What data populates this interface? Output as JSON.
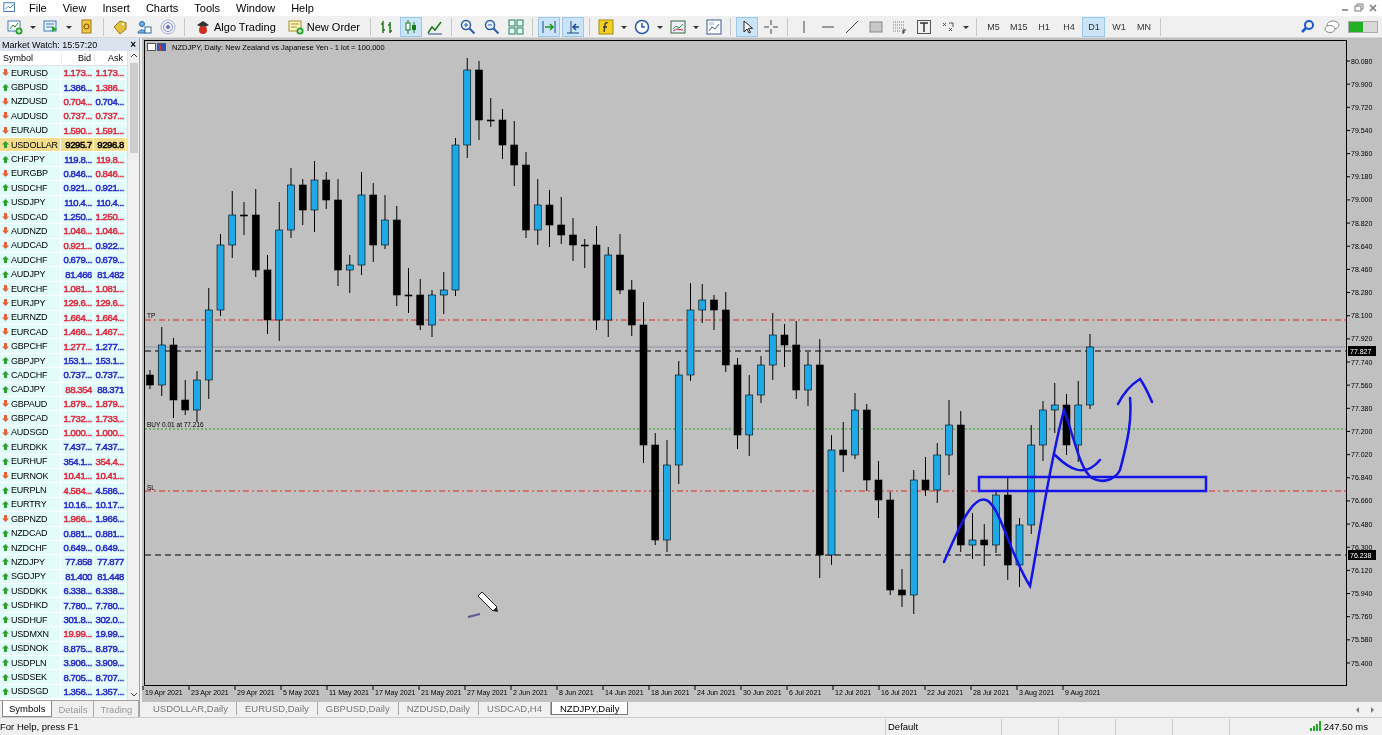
{
  "menu": [
    "File",
    "View",
    "Insert",
    "Charts",
    "Tools",
    "Window",
    "Help"
  ],
  "toolbar": {
    "buttons": [
      "Algo Trading",
      "New Order"
    ],
    "chart_types": [
      {
        "selected": false
      },
      {
        "selected": true
      },
      {
        "selected": false
      }
    ],
    "chart_shift": {
      "on": true
    },
    "auto_scroll": {
      "on": true
    },
    "tools": [
      {
        "selected": true
      },
      {
        "selected": false
      },
      {
        "selected": false
      },
      {
        "selected": false
      },
      {
        "selected": false
      },
      {
        "selected": false
      },
      {
        "selected": false
      },
      {
        "selected": false
      },
      {
        "selected": false
      }
    ],
    "timeframes": [
      {
        "label": "M5",
        "selected": false
      },
      {
        "label": "M15",
        "selected": false
      },
      {
        "label": "H1",
        "selected": false
      },
      {
        "label": "H4",
        "selected": false
      },
      {
        "label": "D1",
        "selected": true
      },
      {
        "label": "W1",
        "selected": false
      },
      {
        "label": "MN",
        "selected": false
      }
    ]
  },
  "market_watch": {
    "title": "Market Watch: 15:57:20",
    "close": "×",
    "columns": [
      "Symbol",
      "Bid",
      "Ask"
    ],
    "rows": [
      {
        "symbol": "EURUSD",
        "rising": false,
        "bid": {
          "text": "1.173...",
          "color": "#e0283c"
        },
        "ask": {
          "text": "1.173...",
          "color": "#e0283c"
        },
        "selected": false
      },
      {
        "symbol": "GBPUSD",
        "rising": true,
        "bid": {
          "text": "1.386...",
          "color": "#2a2ac8"
        },
        "ask": {
          "text": "1.386...",
          "color": "#e0283c"
        },
        "selected": false
      },
      {
        "symbol": "NZDUSD",
        "rising": false,
        "bid": {
          "text": "0.704...",
          "color": "#e0283c"
        },
        "ask": {
          "text": "0.704...",
          "color": "#2a2ac8"
        },
        "selected": false
      },
      {
        "symbol": "AUDUSD",
        "rising": false,
        "bid": {
          "text": "0.737...",
          "color": "#e0283c"
        },
        "ask": {
          "text": "0.737...",
          "color": "#e0283c"
        },
        "selected": false
      },
      {
        "symbol": "EURAUD",
        "rising": false,
        "bid": {
          "text": "1.590...",
          "color": "#e0283c"
        },
        "ask": {
          "text": "1.591...",
          "color": "#e0283c"
        },
        "selected": false
      },
      {
        "symbol": "USDOLLAR",
        "rising": true,
        "bid": {
          "text": "9295.7"
        },
        "ask": {
          "text": "9296.8"
        },
        "selected": true
      },
      {
        "symbol": "CHFJPY",
        "rising": true,
        "bid": {
          "text": "119.8...",
          "color": "#2a2ac8"
        },
        "ask": {
          "text": "119.8...",
          "color": "#e0283c"
        },
        "selected": false
      },
      {
        "symbol": "EURGBP",
        "rising": false,
        "bid": {
          "text": "0.846...",
          "color": "#2a2ac8"
        },
        "ask": {
          "text": "0.846...",
          "color": "#e0283c"
        },
        "selected": false
      },
      {
        "symbol": "USDCHF",
        "rising": true,
        "bid": {
          "text": "0.921...",
          "color": "#2a2ac8"
        },
        "ask": {
          "text": "0.921...",
          "color": "#2a2ac8"
        },
        "selected": false
      },
      {
        "symbol": "USDJPY",
        "rising": true,
        "bid": {
          "text": "110.4...",
          "color": "#2a2ac8"
        },
        "ask": {
          "text": "110.4...",
          "color": "#2a2ac8"
        },
        "selected": false
      },
      {
        "symbol": "USDCAD",
        "rising": false,
        "bid": {
          "text": "1.250...",
          "color": "#2a2ac8"
        },
        "ask": {
          "text": "1.250...",
          "color": "#e0283c"
        },
        "selected": false
      },
      {
        "symbol": "AUDNZD",
        "rising": false,
        "bid": {
          "text": "1.046...",
          "color": "#e0283c"
        },
        "ask": {
          "text": "1.046...",
          "color": "#e0283c"
        },
        "selected": false
      },
      {
        "symbol": "AUDCAD",
        "rising": false,
        "bid": {
          "text": "0.921...",
          "color": "#e0283c"
        },
        "ask": {
          "text": "0.922...",
          "color": "#2a2ac8"
        },
        "selected": false
      },
      {
        "symbol": "AUDCHF",
        "rising": true,
        "bid": {
          "text": "0.679...",
          "color": "#2a2ac8"
        },
        "ask": {
          "text": "0.679...",
          "color": "#2a2ac8"
        },
        "selected": false
      },
      {
        "symbol": "AUDJPY",
        "rising": true,
        "bid": {
          "text": "81.466",
          "color": "#2a2ac8"
        },
        "ask": {
          "text": "81.482",
          "color": "#2a2ac8"
        },
        "selected": false
      },
      {
        "symbol": "EURCHF",
        "rising": false,
        "bid": {
          "text": "1.081...",
          "color": "#e0283c"
        },
        "ask": {
          "text": "1.081...",
          "color": "#e0283c"
        },
        "selected": false
      },
      {
        "symbol": "EURJPY",
        "rising": false,
        "bid": {
          "text": "129.6...",
          "color": "#e0283c"
        },
        "ask": {
          "text": "129.6...",
          "color": "#e0283c"
        },
        "selected": false
      },
      {
        "symbol": "EURNZD",
        "rising": false,
        "bid": {
          "text": "1.664...",
          "color": "#e0283c"
        },
        "ask": {
          "text": "1.664...",
          "color": "#e0283c"
        },
        "selected": false
      },
      {
        "symbol": "EURCAD",
        "rising": false,
        "bid": {
          "text": "1.466...",
          "color": "#e0283c"
        },
        "ask": {
          "text": "1.467...",
          "color": "#e0283c"
        },
        "selected": false
      },
      {
        "symbol": "GBPCHF",
        "rising": false,
        "bid": {
          "text": "1.277...",
          "color": "#e0283c"
        },
        "ask": {
          "text": "1.277...",
          "color": "#2a2ac8"
        },
        "selected": false
      },
      {
        "symbol": "GBPJPY",
        "rising": true,
        "bid": {
          "text": "153.1...",
          "color": "#2a2ac8"
        },
        "ask": {
          "text": "153.1...",
          "color": "#2a2ac8"
        },
        "selected": false
      },
      {
        "symbol": "CADCHF",
        "rising": true,
        "bid": {
          "text": "0.737...",
          "color": "#2a2ac8"
        },
        "ask": {
          "text": "0.737...",
          "color": "#2a2ac8"
        },
        "selected": false
      },
      {
        "symbol": "CADJPY",
        "rising": true,
        "bid": {
          "text": "88.354",
          "color": "#e0283c"
        },
        "ask": {
          "text": "88.371",
          "color": "#2a2ac8"
        },
        "selected": false
      },
      {
        "symbol": "GBPAUD",
        "rising": false,
        "bid": {
          "text": "1.879...",
          "color": "#e0283c"
        },
        "ask": {
          "text": "1.879...",
          "color": "#e0283c"
        },
        "selected": false
      },
      {
        "symbol": "GBPCAD",
        "rising": false,
        "bid": {
          "text": "1.732...",
          "color": "#e0283c"
        },
        "ask": {
          "text": "1.733...",
          "color": "#e0283c"
        },
        "selected": false
      },
      {
        "symbol": "AUDSGD",
        "rising": false,
        "bid": {
          "text": "1.000...",
          "color": "#e0283c"
        },
        "ask": {
          "text": "1.000...",
          "color": "#e0283c"
        },
        "selected": false
      },
      {
        "symbol": "EURDKK",
        "rising": true,
        "bid": {
          "text": "7.437...",
          "color": "#2a2ac8"
        },
        "ask": {
          "text": "7.437...",
          "color": "#2a2ac8"
        },
        "selected": false
      },
      {
        "symbol": "EURHUF",
        "rising": true,
        "bid": {
          "text": "354.1...",
          "color": "#2a2ac8"
        },
        "ask": {
          "text": "354.4...",
          "color": "#e0283c"
        },
        "selected": false
      },
      {
        "symbol": "EURNOK",
        "rising": false,
        "bid": {
          "text": "10.41...",
          "color": "#e0283c"
        },
        "ask": {
          "text": "10.41...",
          "color": "#e0283c"
        },
        "selected": false
      },
      {
        "symbol": "EURPLN",
        "rising": true,
        "bid": {
          "text": "4.584...",
          "color": "#e0283c"
        },
        "ask": {
          "text": "4.586...",
          "color": "#2a2ac8"
        },
        "selected": false
      },
      {
        "symbol": "EURTRY",
        "rising": true,
        "bid": {
          "text": "10.16...",
          "color": "#2a2ac8"
        },
        "ask": {
          "text": "10.17...",
          "color": "#2a2ac8"
        },
        "selected": false
      },
      {
        "symbol": "GBPNZD",
        "rising": false,
        "bid": {
          "text": "1.966...",
          "color": "#e0283c"
        },
        "ask": {
          "text": "1.966...",
          "color": "#2a2ac8"
        },
        "selected": false
      },
      {
        "symbol": "NZDCAD",
        "rising": true,
        "bid": {
          "text": "0.881...",
          "color": "#2a2ac8"
        },
        "ask": {
          "text": "0.881...",
          "color": "#2a2ac8"
        },
        "selected": false
      },
      {
        "symbol": "NZDCHF",
        "rising": true,
        "bid": {
          "text": "0.649...",
          "color": "#2a2ac8"
        },
        "ask": {
          "text": "0.649...",
          "color": "#2a2ac8"
        },
        "selected": false
      },
      {
        "symbol": "NZDJPY",
        "rising": true,
        "bid": {
          "text": "77.858",
          "color": "#2a2ac8"
        },
        "ask": {
          "text": "77.877",
          "color": "#2a2ac8"
        },
        "selected": false
      },
      {
        "symbol": "SGDJPY",
        "rising": true,
        "bid": {
          "text": "81.400",
          "color": "#2a2ac8"
        },
        "ask": {
          "text": "81.448",
          "color": "#2a2ac8"
        },
        "selected": false
      },
      {
        "symbol": "USDDKK",
        "rising": true,
        "bid": {
          "text": "6.338...",
          "color": "#2a2ac8"
        },
        "ask": {
          "text": "6.338...",
          "color": "#2a2ac8"
        },
        "selected": false
      },
      {
        "symbol": "USDHKD",
        "rising": true,
        "bid": {
          "text": "7.780...",
          "color": "#2a2ac8"
        },
        "ask": {
          "text": "7.780...",
          "color": "#2a2ac8"
        },
        "selected": false
      },
      {
        "symbol": "USDHUF",
        "rising": true,
        "bid": {
          "text": "301.8...",
          "color": "#2a2ac8"
        },
        "ask": {
          "text": "302.0...",
          "color": "#2a2ac8"
        },
        "selected": false
      },
      {
        "symbol": "USDMXN",
        "rising": true,
        "bid": {
          "text": "19.99...",
          "color": "#e0283c"
        },
        "ask": {
          "text": "19.99...",
          "color": "#2a2ac8"
        },
        "selected": false
      },
      {
        "symbol": "USDNOK",
        "rising": true,
        "bid": {
          "text": "8.875...",
          "color": "#2a2ac8"
        },
        "ask": {
          "text": "8.879...",
          "color": "#2a2ac8"
        },
        "selected": false
      },
      {
        "symbol": "USDPLN",
        "rising": true,
        "bid": {
          "text": "3.906...",
          "color": "#2a2ac8"
        },
        "ask": {
          "text": "3.909...",
          "color": "#2a2ac8"
        },
        "selected": false
      },
      {
        "symbol": "USDSEK",
        "rising": true,
        "bid": {
          "text": "8.705...",
          "color": "#2a2ac8"
        },
        "ask": {
          "text": "8.707...",
          "color": "#2a2ac8"
        },
        "selected": false
      },
      {
        "symbol": "USDSGD",
        "rising": true,
        "bid": {
          "text": "1.356...",
          "color": "#2a2ac8"
        },
        "ask": {
          "text": "1.357...",
          "color": "#2a2ac8"
        },
        "selected": false
      }
    ],
    "tabs": [
      {
        "label": "Symbols",
        "selected": true
      },
      {
        "label": "Details",
        "selected": false
      },
      {
        "label": "Trading",
        "selected": false
      }
    ]
  },
  "chart": {
    "header": "NZDJPY, Daily:  New Zealand vs Japanese Yen - 1 lot = 100,000",
    "order_labels": [
      "TP",
      "BUY 0.01 at 77.216",
      "SL"
    ],
    "price_labels": [
      "80.080",
      "79.900",
      "79.720",
      "79.540",
      "79.360",
      "79.180",
      "79.000",
      "78.820",
      "78.640",
      "78.460",
      "78.280",
      "78.100",
      "77.920",
      "77.740",
      "77.560",
      "77.380",
      "77.200",
      "77.020",
      "76.840",
      "76.660",
      "76.480",
      "76.300",
      "76.120",
      "75.940",
      "75.760",
      "75.580",
      "75.400"
    ],
    "price_tags": [
      "77.827",
      "76.238"
    ],
    "date_labels": [
      "19 Apr 2021",
      "23 Apr 2021",
      "29 Apr 2021",
      "5 May 2021",
      "11 May 2021",
      "17 May 2021",
      "21 May 2021",
      "27 May 2021",
      "2 Jun 2021",
      "8 Jun 2021",
      "14 Jun 2021",
      "18 Jun 2021",
      "24 Jun 2021",
      "30 Jun 2021",
      "6 Jul 2021",
      "12 Jul 2021",
      "16 Jul 2021",
      "22 Jul 2021",
      "28 Jul 2021",
      "3 Aug 2021",
      "9 Aug 2021"
    ]
  },
  "chart_tabs": [
    {
      "label": "USDOLLAR,Daily",
      "selected": false
    },
    {
      "label": "EURUSD,Daily",
      "selected": false
    },
    {
      "label": "GBPUSD,Daily",
      "selected": false
    },
    {
      "label": "NZDUSD,Daily",
      "selected": false
    },
    {
      "label": "USDCAD,H4",
      "selected": false
    },
    {
      "label": "NZDJPY,Daily",
      "selected": true
    }
  ],
  "status_bar": {
    "help": "For Help, press F1",
    "profile": "Default",
    "ping": "247.50 ms"
  }
}
